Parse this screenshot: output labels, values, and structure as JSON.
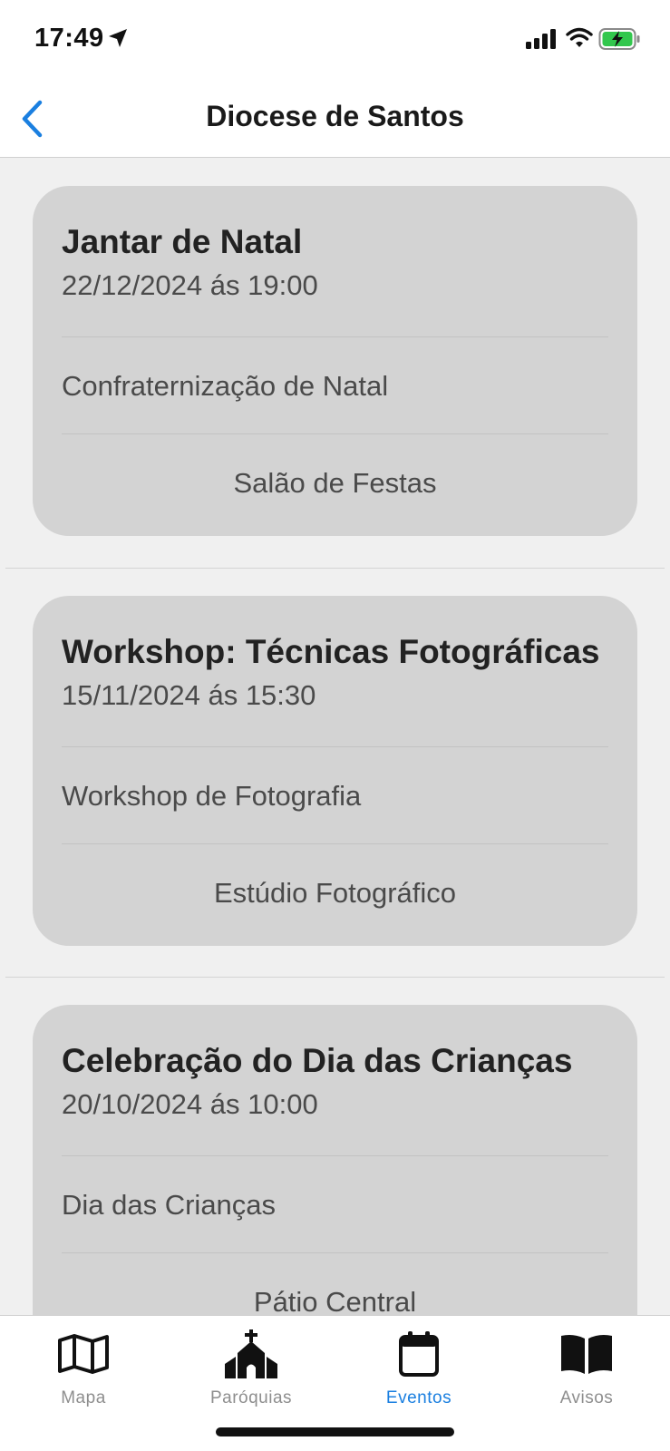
{
  "status_bar": {
    "time": "17:49"
  },
  "nav": {
    "title": "Diocese de Santos"
  },
  "events": [
    {
      "title": "Jantar de Natal",
      "date": "22/12/2024 ás 19:00",
      "description": "Confraternização de Natal",
      "place": "Salão de Festas"
    },
    {
      "title": "Workshop: Técnicas Fotográficas",
      "date": "15/11/2024 ás 15:30",
      "description": "Workshop de Fotografia",
      "place": "Estúdio Fotográfico"
    },
    {
      "title": "Celebração do Dia das Crianças",
      "date": "20/10/2024 ás 10:00",
      "description": "Dia das Crianças",
      "place": "Pátio Central"
    }
  ],
  "tabs": [
    {
      "label": "Mapa",
      "icon": "map-icon",
      "active": false
    },
    {
      "label": "Paróquias",
      "icon": "church-icon",
      "active": false
    },
    {
      "label": "Eventos",
      "icon": "calendar-icon",
      "active": true
    },
    {
      "label": "Avisos",
      "icon": "book-icon",
      "active": false
    }
  ],
  "colors": {
    "accent": "#1a7fe0",
    "card": "#d3d3d3",
    "background": "#f0f0f0"
  }
}
